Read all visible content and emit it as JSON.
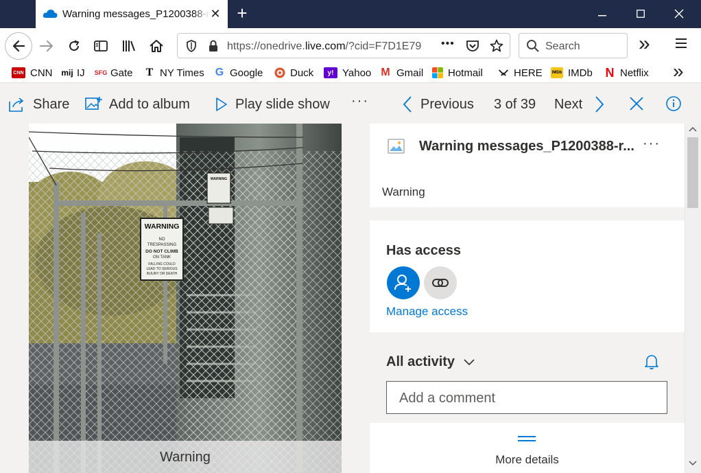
{
  "browser": {
    "tab_title": "Warning messages_P1200388-r",
    "tab_close": "✕",
    "new_tab": "+",
    "window_controls": {
      "minimize": "—",
      "maximize": "☐",
      "close": "✕"
    },
    "url_prefix": "https://onedrive.",
    "url_domain": "live.com",
    "url_suffix": "/?cid=F7D1E79",
    "url_more": "•••",
    "search_placeholder": "Search",
    "overflow": "»",
    "menu": "≡"
  },
  "bookmarks": [
    {
      "label": "CNN",
      "icon": "cnn-icon",
      "color": "#cc0000"
    },
    {
      "label": "IJ",
      "icon": "mij-icon",
      "color": "#000000"
    },
    {
      "label": "Gate",
      "icon": "sfgate-icon",
      "color": "#d02020"
    },
    {
      "label": "NY Times",
      "icon": "nytimes-icon",
      "color": "#000000"
    },
    {
      "label": "Google",
      "icon": "google-icon",
      "color": "#4285f4"
    },
    {
      "label": "Duck",
      "icon": "duckduckgo-icon",
      "color": "#de5833"
    },
    {
      "label": "Yahoo",
      "icon": "yahoo-icon",
      "color": "#6001d2"
    },
    {
      "label": "Gmail",
      "icon": "gmail-icon",
      "color": "#d93025"
    },
    {
      "label": "Hotmail",
      "icon": "hotmail-icon",
      "color": "#f25022"
    },
    {
      "label": "HERE",
      "icon": "here-icon",
      "color": "#222222"
    },
    {
      "label": "IMDb",
      "icon": "imdb-icon",
      "color": "#f5c518"
    },
    {
      "label": "Netflix",
      "icon": "netflix-icon",
      "color": "#e50914"
    }
  ],
  "bookmark_glyphs": {
    "cnn": "CNN",
    "mij": "mij",
    "sfgate": "SFG",
    "nyt": "T",
    "google": "G",
    "yahoo": "y!",
    "gmail": "M",
    "imdb": "IMDb",
    "netflix": "N"
  },
  "toolbar": {
    "share": "Share",
    "add_to_album": "Add to album",
    "play_slide_show": "Play slide show",
    "more": "···",
    "previous": "Previous",
    "counter": "3 of 39",
    "next": "Next"
  },
  "photo": {
    "caption": "Warning",
    "sign_main": "WARNING",
    "sign_lines": [
      "NO",
      "TRESPASSING",
      "DO NOT CLIMB",
      "ON TANK",
      "FALLING COULD",
      "LEAD TO SERIOUS",
      "INJURY OR DEATH"
    ],
    "sign_small": "WARNING"
  },
  "details": {
    "file_name": "Warning messages_P1200388-r...",
    "more": "···",
    "description": "Warning",
    "has_access_heading": "Has access",
    "manage_access": "Manage access",
    "all_activity": "All activity",
    "comment_placeholder": "Add a comment",
    "more_details": "More details"
  },
  "colors": {
    "accent": "#0078d4",
    "titlebar": "#1f2b49",
    "pane_bg": "#f3f2f1"
  }
}
